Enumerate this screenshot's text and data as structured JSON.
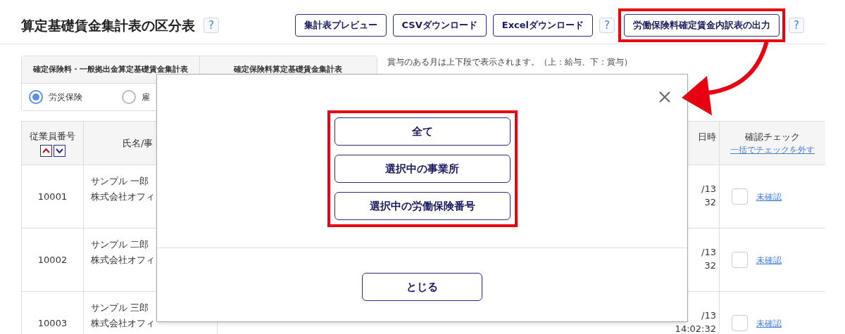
{
  "header": {
    "title": "算定基礎賃金集計表の区分表",
    "title_help": "?",
    "buttons": [
      {
        "label": "集計表プレビュー",
        "highlighted": false
      },
      {
        "label": "CSVダウンロード",
        "highlighted": false
      },
      {
        "label": "Excelダウンロード",
        "highlighted": false
      },
      {
        "label": "?",
        "kind": "help"
      },
      {
        "label": "労働保険料確定賃金内訳表の出力",
        "highlighted": true
      },
      {
        "label": "?",
        "kind": "help"
      }
    ]
  },
  "report_tabs": [
    {
      "label": "確定保険料・一般拠出金算定基礎賃金集計表"
    },
    {
      "label": "確定保険料算定基礎賃金集計表"
    }
  ],
  "insurance_radios": [
    {
      "label": "労災保険",
      "selected": true
    },
    {
      "label": "雇",
      "selected": false
    }
  ],
  "note": "賞与のある月は上下段で表示されます。（上：給与、下：賞与）",
  "table": {
    "columns": {
      "employee_no": "従業員番号",
      "name": "氏名/事",
      "datetime": "日時",
      "check": "確認チェック",
      "check_link": "一括でチェックを外す"
    },
    "rows": [
      {
        "employee_no": "10001",
        "name": "サンプル 一郎",
        "office": "株式会社オフィ",
        "date": "/13",
        "time": "32",
        "checked": false,
        "status": "未確認"
      },
      {
        "employee_no": "10002",
        "name": "サンプル 二郎",
        "office": "株式会社オフィ",
        "date": "/13",
        "time": "32",
        "checked": false,
        "status": "未確認"
      },
      {
        "employee_no": "10003",
        "name": "サンプル 三郎",
        "office": "株式会社オフィ",
        "date": "/13",
        "time": "14:02:32",
        "checked": false,
        "status": "未確認"
      }
    ]
  },
  "dialog": {
    "options": [
      {
        "label": "全て"
      },
      {
        "label": "選択中の事業所"
      },
      {
        "label": "選択中の労働保険番号"
      }
    ],
    "close_button": "とじる"
  }
}
